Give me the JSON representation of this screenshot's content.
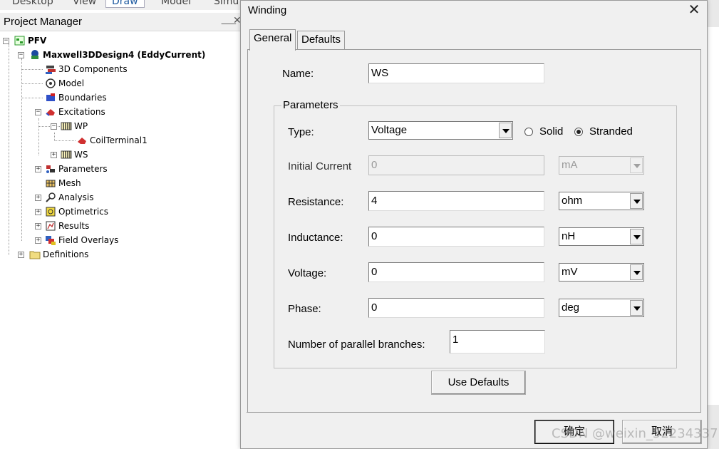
{
  "menubar": {
    "items": [
      "Desktop",
      "View",
      "Draw",
      "Model",
      "Simu"
    ],
    "active_index": 2
  },
  "project_manager": {
    "title": "Project Manager",
    "pin_glyph": "░",
    "close_glyph": "✕",
    "tree": [
      {
        "label": "PFV",
        "bold": true,
        "icon": "project-icon"
      },
      {
        "label": "Maxwell3DDesign4 (EddyCurrent)",
        "bold": true,
        "icon": "design-icon"
      },
      {
        "label": "3D Components",
        "icon": "components-icon"
      },
      {
        "label": "Model",
        "icon": "model-icon"
      },
      {
        "label": "Boundaries",
        "icon": "boundaries-icon"
      },
      {
        "label": "Excitations",
        "icon": "excitations-icon"
      },
      {
        "label": "WP",
        "icon": "winding-icon"
      },
      {
        "label": "CoilTerminal1",
        "icon": "coil-terminal-icon"
      },
      {
        "label": "WS",
        "icon": "winding-icon"
      },
      {
        "label": "Parameters",
        "icon": "parameters-icon"
      },
      {
        "label": "Mesh",
        "icon": "mesh-icon"
      },
      {
        "label": "Analysis",
        "icon": "analysis-icon"
      },
      {
        "label": "Optimetrics",
        "icon": "optimetrics-icon"
      },
      {
        "label": "Results",
        "icon": "results-icon"
      },
      {
        "label": "Field Overlays",
        "icon": "field-overlays-icon"
      },
      {
        "label": "Definitions",
        "icon": "folder-icon"
      }
    ]
  },
  "dialog": {
    "title": "Winding",
    "close_glyph": "✕",
    "tabs": [
      {
        "label": "General",
        "active": true
      },
      {
        "label": "Defaults",
        "active": false
      }
    ],
    "name": {
      "label": "Name:",
      "value": "WS"
    },
    "parameters": {
      "title": "Parameters",
      "type": {
        "label": "Type:",
        "value": "Voltage",
        "options": {
          "solid": "Solid",
          "stranded": "Stranded"
        },
        "selected": "stranded"
      },
      "initial_current": {
        "label": "Initial Current",
        "value": "0",
        "unit": "mA",
        "enabled": false
      },
      "resistance": {
        "label": "Resistance:",
        "value": "4",
        "unit": "ohm"
      },
      "inductance": {
        "label": "Inductance:",
        "value": "0",
        "unit": "nH"
      },
      "voltage": {
        "label": "Voltage:",
        "value": "0",
        "unit": "mV"
      },
      "phase": {
        "label": "Phase:",
        "value": "0",
        "unit": "deg"
      },
      "parallel_branches": {
        "label": "Number of parallel branches:",
        "value": "1"
      }
    },
    "use_defaults_label": "Use Defaults",
    "ok_label": "确定",
    "cancel_label": "取消"
  },
  "watermark": "CSDN @weixin_52234337"
}
